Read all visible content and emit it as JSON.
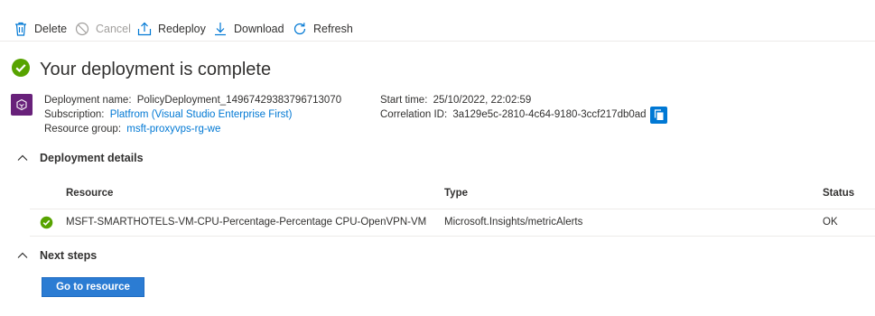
{
  "toolbar": {
    "delete_label": "Delete",
    "cancel_label": "Cancel",
    "redeploy_label": "Redeploy",
    "download_label": "Download",
    "refresh_label": "Refresh"
  },
  "header": {
    "title": "Your deployment is complete"
  },
  "deployment": {
    "name_label": "Deployment name:",
    "name_value": "PolicyDeployment_14967429383796713070",
    "subscription_label": "Subscription:",
    "subscription_value": "Platfrom (Visual Studio Enterprise First)",
    "resource_group_label": "Resource group:",
    "resource_group_value": "msft-proxyvps-rg-we",
    "start_time_label": "Start time:",
    "start_time_value": "25/10/2022, 22:02:59",
    "correlation_label": "Correlation ID:",
    "correlation_value": "3a129e5c-2810-4c64-9180-3ccf217db0ad"
  },
  "details": {
    "section_label": "Deployment details",
    "columns": [
      "Resource",
      "Type",
      "Status"
    ],
    "rows": [
      {
        "resource": "MSFT-SMARTHOTELS-VM-CPU-Percentage-Percentage CPU-OpenVPN-VM",
        "type": "Microsoft.Insights/metricAlerts",
        "status": "OK"
      }
    ]
  },
  "next_steps": {
    "section_label": "Next steps",
    "button_label": "Go to resource"
  },
  "colors": {
    "accent": "#0078d4",
    "success": "#57a300",
    "resource_icon_bg": "#68217a"
  },
  "icons": {
    "delete": "trash-icon",
    "cancel": "cancel-icon",
    "redeploy": "upload-icon",
    "download": "download-icon",
    "refresh": "refresh-icon",
    "status": "check-circle-icon",
    "copy": "copy-icon",
    "section": "chevron-up-icon"
  }
}
